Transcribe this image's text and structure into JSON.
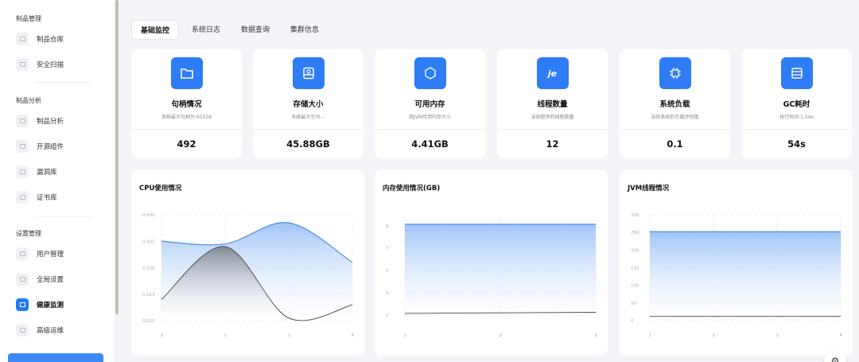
{
  "sidebar": {
    "sections": [
      {
        "title": "制品管理",
        "items": [
          "制品仓库",
          "安全扫描"
        ]
      },
      {
        "title": "制品分析",
        "items": [
          "制品分析",
          "开源组件",
          "漏洞库",
          "证书库"
        ]
      },
      {
        "title": "设置管理",
        "items": [
          "用户管理",
          "全局设置",
          "健康监测",
          "高级运维"
        ]
      }
    ],
    "active_item": "健康监测"
  },
  "tabs": [
    "基础监控",
    "系统日志",
    "数据查询",
    "集群信息"
  ],
  "active_tab": "基础监控",
  "stats": [
    {
      "title": "句柄情况",
      "subtitle": "系统最大句柄为:65536",
      "value": "492",
      "icon": "folder-icon"
    },
    {
      "title": "存储大小",
      "subtitle": "系统最大空间:--",
      "value": "45.88GB",
      "icon": "disk-icon"
    },
    {
      "title": "可用内存",
      "subtitle": "指JVM可用内存大小",
      "value": "4.41GB",
      "icon": "java-icon"
    },
    {
      "title": "线程数量",
      "subtitle": "当前程序的线程数量",
      "value": "12",
      "icon": "je-icon",
      "icon_text": "je"
    },
    {
      "title": "系统负载",
      "subtitle": "当前系统的负载评估值",
      "value": "0.1",
      "icon": "cpu-icon"
    },
    {
      "title": "GC耗时",
      "subtitle": "执行时间:1.54s",
      "value": "54s",
      "icon": "server-icon"
    }
  ],
  "colors": {
    "accent": "#2e7cf6",
    "line": "#4a90e2",
    "dark_line": "#444444"
  },
  "chart_data": [
    {
      "type": "area",
      "title": "CPU使用情况",
      "x": [
        1,
        2,
        3,
        4
      ],
      "yticks": [
        "0.010",
        "0.015",
        "0.020",
        "0.025",
        "0.030"
      ],
      "ylim": [
        0.01,
        0.03
      ],
      "series": [
        {
          "values": [
            0.025,
            0.0245,
            0.0285,
            0.021
          ],
          "fill": true
        },
        {
          "values": [
            0.014,
            0.024,
            0.0105,
            0.013
          ],
          "fill": true
        }
      ]
    },
    {
      "type": "area",
      "title": "内存使用情况(GB)",
      "x": [
        1,
        2,
        3
      ],
      "yticks": [
        "1",
        "3",
        "5",
        "7",
        "9"
      ],
      "ylim": [
        0.5,
        10
      ],
      "series": [
        {
          "values": [
            9.15,
            9.15,
            9.15
          ],
          "fill": true
        },
        {
          "values": [
            1.15,
            1.2,
            1.25
          ],
          "fill": false
        }
      ]
    },
    {
      "type": "area",
      "title": "JVM线程情况",
      "x": [
        1,
        2,
        3,
        4
      ],
      "yticks": [
        "0",
        "50",
        "100",
        "150",
        "200",
        "250",
        "300"
      ],
      "ylim": [
        0,
        300
      ],
      "series": [
        {
          "values": [
            252,
            252,
            252,
            252
          ],
          "fill": true
        },
        {
          "values": [
            12,
            12,
            12,
            12
          ],
          "fill": false
        }
      ]
    }
  ]
}
